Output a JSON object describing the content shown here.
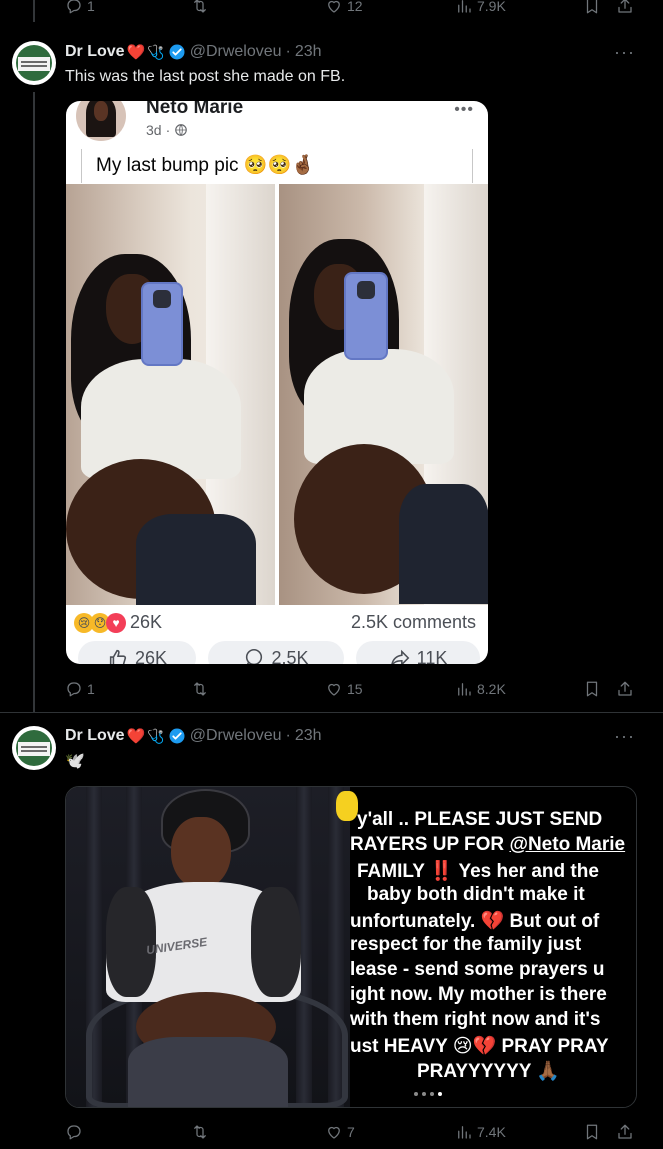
{
  "top_action_bar": {
    "reply_count": "1",
    "retweet_count": "",
    "like_count": "12",
    "view_count": "7.9K"
  },
  "tweet1": {
    "display_name": "Dr Love",
    "name_emojis": "❤️",
    "stethoscope": "🩺",
    "handle": "@Drweloveu",
    "time": "23h",
    "text": "This was the last post she made on FB.",
    "more": "···",
    "embedded_fb_post": {
      "author": "Neto Marie",
      "meta": "3d",
      "caption": "My last bump pic 🥺🥺🤞🏾",
      "reaction_count": "26K",
      "comments": "2.5K comments",
      "like_button": "26K",
      "comment_button": "2.5K",
      "share_button": "11K",
      "dots": "•••"
    },
    "actions": {
      "reply": "1",
      "retweet": "",
      "like": "15",
      "views": "8.2K"
    }
  },
  "tweet2": {
    "display_name": "Dr Love",
    "name_emojis": "❤️",
    "stethoscope": "🩺",
    "handle": "@Drweloveu",
    "time": "23h",
    "text": "🕊️",
    "more": "···",
    "image_left_label": "UNIVERSE",
    "story_lines": [
      "y'all .. PLEASE JUST SEND",
      "RAYERS UP FOR ",
      "FAMILY ‼️ Yes her and the",
      "baby both didn't make it",
      "unfortunately. 💔 But out of",
      "respect for the family just",
      "lease - send some prayers u",
      "ight now. My mother is there",
      "with them right now and it's",
      "ust HEAVY 😢💔 PRAY PRAY",
      "PRAYYYYYY 🙏🏾"
    ],
    "story_mention": "@Neto Marie",
    "actions": {
      "reply": "",
      "retweet": "",
      "like": "7",
      "views": "7.4K"
    }
  },
  "colors": {
    "background": "#000000",
    "text": "#e7e9ea",
    "muted": "#71767b",
    "verified": "#1d9bf0",
    "heart": "#f91880"
  },
  "icons": [
    "reply-icon",
    "retweet-icon",
    "like-icon",
    "views-icon",
    "bookmark-icon",
    "share-icon",
    "verified-icon"
  ]
}
